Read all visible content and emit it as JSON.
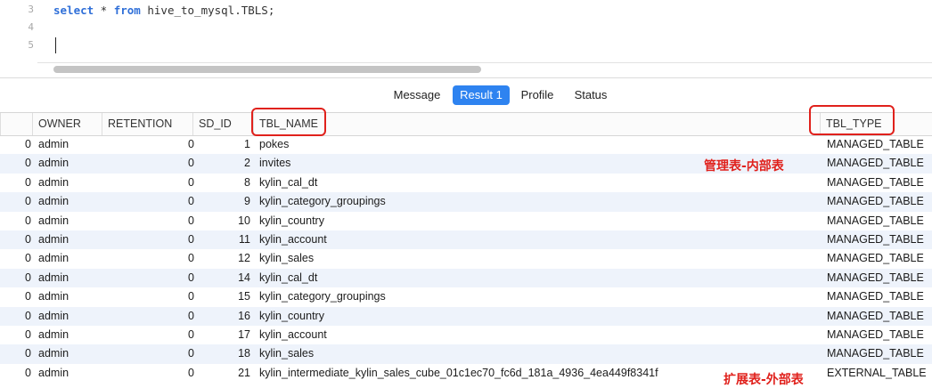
{
  "editor": {
    "line_numbers": [
      "3",
      "4",
      "5"
    ],
    "code_keyword_select": "select",
    "code_star": " * ",
    "code_keyword_from": "from",
    "code_rest": " hive_to_mysql.TBLS;"
  },
  "tabs": [
    {
      "label": "Message",
      "active": false
    },
    {
      "label": "Result 1",
      "active": true
    },
    {
      "label": "Profile",
      "active": false
    },
    {
      "label": "Status",
      "active": false
    }
  ],
  "grid": {
    "columns": [
      "OWNER",
      "RETENTION",
      "SD_ID",
      "TBL_NAME",
      "TBL_TYPE"
    ],
    "rows": [
      {
        "idx": "0",
        "owner": "admin",
        "retention": "0",
        "sd_id": "1",
        "tbl_name": "pokes",
        "tbl_type": "MANAGED_TABLE"
      },
      {
        "idx": "0",
        "owner": "admin",
        "retention": "0",
        "sd_id": "2",
        "tbl_name": "invites",
        "tbl_type": "MANAGED_TABLE"
      },
      {
        "idx": "0",
        "owner": "admin",
        "retention": "0",
        "sd_id": "8",
        "tbl_name": "kylin_cal_dt",
        "tbl_type": "MANAGED_TABLE"
      },
      {
        "idx": "0",
        "owner": "admin",
        "retention": "0",
        "sd_id": "9",
        "tbl_name": "kylin_category_groupings",
        "tbl_type": "MANAGED_TABLE"
      },
      {
        "idx": "0",
        "owner": "admin",
        "retention": "0",
        "sd_id": "10",
        "tbl_name": "kylin_country",
        "tbl_type": "MANAGED_TABLE"
      },
      {
        "idx": "0",
        "owner": "admin",
        "retention": "0",
        "sd_id": "11",
        "tbl_name": "kylin_account",
        "tbl_type": "MANAGED_TABLE"
      },
      {
        "idx": "0",
        "owner": "admin",
        "retention": "0",
        "sd_id": "12",
        "tbl_name": "kylin_sales",
        "tbl_type": "MANAGED_TABLE"
      },
      {
        "idx": "0",
        "owner": "admin",
        "retention": "0",
        "sd_id": "14",
        "tbl_name": "kylin_cal_dt",
        "tbl_type": "MANAGED_TABLE"
      },
      {
        "idx": "0",
        "owner": "admin",
        "retention": "0",
        "sd_id": "15",
        "tbl_name": "kylin_category_groupings",
        "tbl_type": "MANAGED_TABLE"
      },
      {
        "idx": "0",
        "owner": "admin",
        "retention": "0",
        "sd_id": "16",
        "tbl_name": "kylin_country",
        "tbl_type": "MANAGED_TABLE"
      },
      {
        "idx": "0",
        "owner": "admin",
        "retention": "0",
        "sd_id": "17",
        "tbl_name": "kylin_account",
        "tbl_type": "MANAGED_TABLE"
      },
      {
        "idx": "0",
        "owner": "admin",
        "retention": "0",
        "sd_id": "18",
        "tbl_name": "kylin_sales",
        "tbl_type": "MANAGED_TABLE"
      },
      {
        "idx": "0",
        "owner": "admin",
        "retention": "0",
        "sd_id": "21",
        "tbl_name": "kylin_intermediate_kylin_sales_cube_01c1ec70_fc6d_181a_4936_4ea449f8341f",
        "tbl_type": "EXTERNAL_TABLE"
      }
    ]
  },
  "annotations": {
    "managed_note": "管理表-内部表",
    "external_note": "扩展表-外部表",
    "color": "#e0211c"
  },
  "colors": {
    "accent": "#2e83f0",
    "keyword": "#2f6fd8",
    "alt_row": "#eef3fb"
  }
}
